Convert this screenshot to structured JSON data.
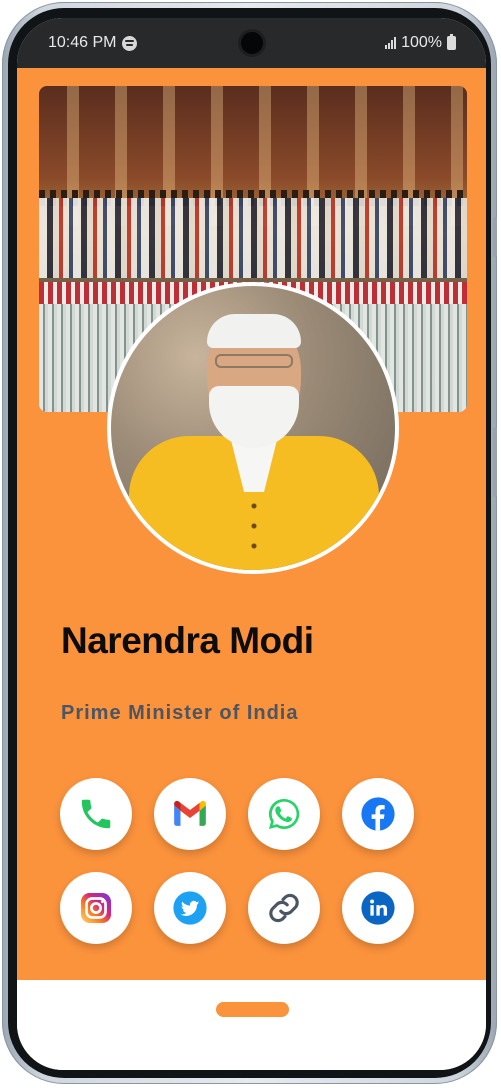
{
  "status_bar": {
    "time": "10:46 PM",
    "battery": "100%",
    "left_icons": [
      "spotify-icon"
    ],
    "right_icons": [
      "signal-icon",
      "battery-icon"
    ]
  },
  "profile": {
    "name": "Narendra Modi",
    "title": "Prime Minister of India"
  },
  "social_links": [
    {
      "name": "phone",
      "icon": "phone-icon",
      "color": "#22c55e"
    },
    {
      "name": "gmail",
      "icon": "gmail-icon",
      "color": "#ea4335"
    },
    {
      "name": "whatsapp",
      "icon": "whatsapp-icon",
      "color": "#25d366"
    },
    {
      "name": "facebook",
      "icon": "facebook-icon",
      "color": "#1877f2"
    },
    {
      "name": "instagram",
      "icon": "instagram-icon",
      "color": "#e1306c"
    },
    {
      "name": "twitter",
      "icon": "twitter-icon",
      "color": "#1da1f2"
    },
    {
      "name": "website",
      "icon": "link-icon",
      "color": "#4b5563"
    },
    {
      "name": "linkedin",
      "icon": "linkedin-icon",
      "color": "#0a66c2"
    }
  ],
  "colors": {
    "card_background": "#fb923c",
    "name_text": "#0c0c0c",
    "title_text": "#4b5563",
    "home_indicator": "#fb923c"
  }
}
